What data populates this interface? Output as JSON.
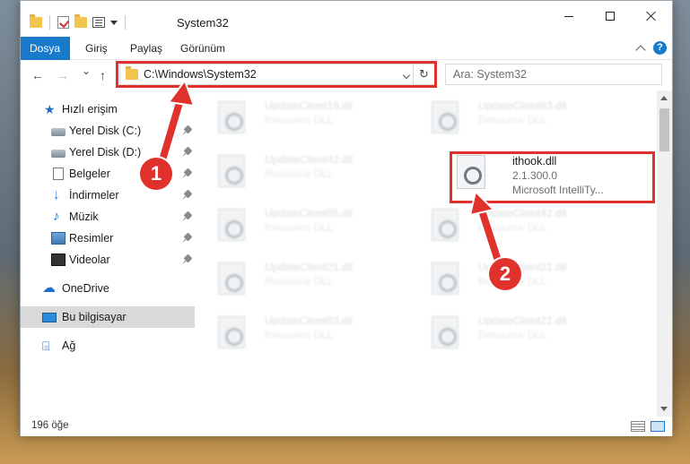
{
  "window": {
    "title": "System32",
    "colors": {
      "accent": "#1979ca",
      "highlight": "#e0312d"
    }
  },
  "ribbon": {
    "tabs": [
      {
        "label": "Dosya",
        "active": true
      },
      {
        "label": "Giriş",
        "active": false
      },
      {
        "label": "Paylaş",
        "active": false
      },
      {
        "label": "Görünüm",
        "active": false
      }
    ],
    "help_label": "?"
  },
  "nav": {
    "back_label": "←",
    "forward_label": "→",
    "recent_label": "⌄",
    "up_label": "↑",
    "address": "C:\\Windows\\System32",
    "refresh_label": "↻",
    "search_placeholder": "Ara: System32"
  },
  "sidebar": {
    "items": [
      {
        "label": "Hızlı erişim",
        "icon": "star-icon",
        "pinned": false
      },
      {
        "label": "Yerel Disk (C:)",
        "icon": "disk-icon",
        "pinned": true
      },
      {
        "label": "Yerel Disk (D:)",
        "icon": "disk-icon",
        "pinned": true
      },
      {
        "label": "Belgeler",
        "icon": "document-icon",
        "pinned": true
      },
      {
        "label": "İndirmeler",
        "icon": "download-icon",
        "pinned": true
      },
      {
        "label": "Müzik",
        "icon": "music-icon",
        "pinned": true
      },
      {
        "label": "Resimler",
        "icon": "pictures-icon",
        "pinned": true
      },
      {
        "label": "Videolar",
        "icon": "videos-icon",
        "pinned": true
      },
      {
        "label": "OneDrive",
        "icon": "cloud-icon",
        "pinned": false
      },
      {
        "label": "Bu bilgisayar",
        "icon": "computer-icon",
        "pinned": false,
        "selected": true
      },
      {
        "label": "Ağ",
        "icon": "network-icon",
        "pinned": false
      }
    ]
  },
  "files": {
    "left": [
      {
        "name": "UpdateClient19.dll",
        "desc": "Resource DLL"
      },
      {
        "name": "UpdateClient42.dll",
        "desc": "Resource DLL"
      },
      {
        "name": "UpdateClient65.dll",
        "desc": "Resource DLL"
      },
      {
        "name": "UpdateClient21.dll",
        "desc": "Resource DLL"
      },
      {
        "name": "UpdateClient63.dll",
        "desc": "Resource DLL"
      }
    ],
    "right": [
      {
        "name": "UpdateClient63.dll",
        "desc": "Resource DLL"
      },
      {
        "name": "UpdateClient42.dll",
        "desc": "Resource DLL"
      },
      {
        "name": "UpdateClient21.dll",
        "desc": "Resource DLL"
      },
      {
        "name": "UpdateClient21.dll",
        "desc": "Resource DLL"
      }
    ],
    "selected": {
      "name": "ithook.dll",
      "version": "2.1.300.0",
      "desc": "Microsoft IntelliTy..."
    }
  },
  "status": {
    "count": "196 öğe"
  },
  "annotations": [
    {
      "label": "1"
    },
    {
      "label": "2"
    }
  ]
}
